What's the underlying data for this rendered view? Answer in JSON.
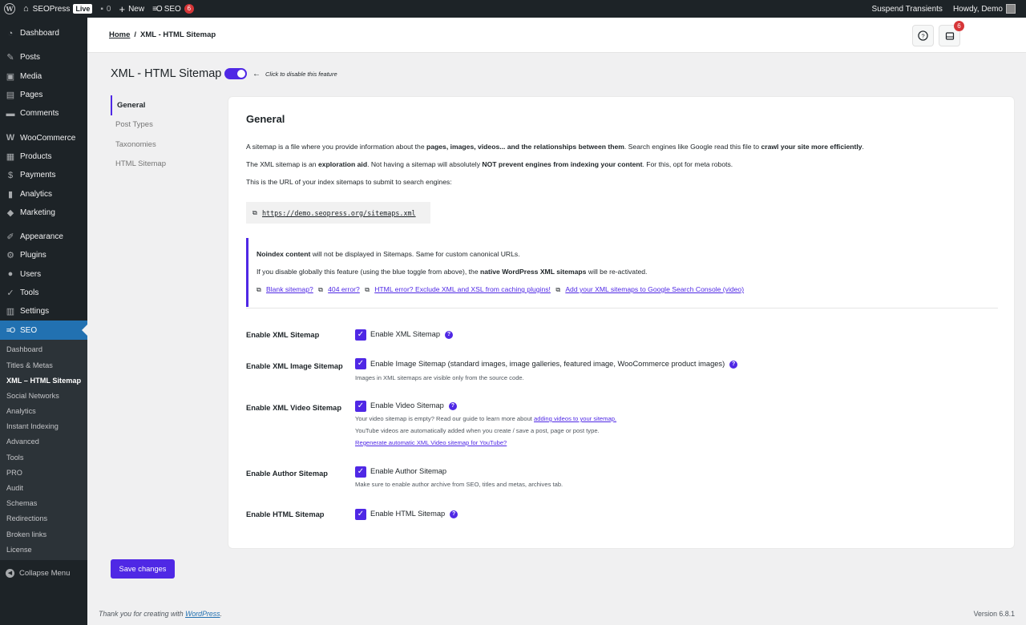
{
  "adminbar": {
    "site_name": "SEOPress",
    "live_badge": "Live",
    "comments_count": "0",
    "new_label": "New",
    "seo_label": "SEO",
    "seo_count": "6",
    "suspend_label": "Suspend Transients",
    "howdy_label": "Howdy, Demo"
  },
  "sidebar": {
    "items": [
      {
        "label": "Dashboard",
        "icon": "dashboard-icon"
      },
      {
        "label": "Posts",
        "icon": "pin-icon"
      },
      {
        "label": "Media",
        "icon": "media-icon"
      },
      {
        "label": "Pages",
        "icon": "page-icon"
      },
      {
        "label": "Comments",
        "icon": "comment-icon"
      },
      {
        "label": "WooCommerce",
        "icon": "woo-icon"
      },
      {
        "label": "Products",
        "icon": "products-icon"
      },
      {
        "label": "Payments",
        "icon": "payments-icon"
      },
      {
        "label": "Analytics",
        "icon": "analytics-icon"
      },
      {
        "label": "Marketing",
        "icon": "megaphone-icon"
      },
      {
        "label": "Appearance",
        "icon": "brush-icon"
      },
      {
        "label": "Plugins",
        "icon": "plug-icon"
      },
      {
        "label": "Users",
        "icon": "user-icon"
      },
      {
        "label": "Tools",
        "icon": "wrench-icon"
      },
      {
        "label": "Settings",
        "icon": "sliders-icon"
      },
      {
        "label": "SEO",
        "icon": "seo-icon"
      }
    ],
    "submenu": [
      "Dashboard",
      "Titles & Metas",
      "XML – HTML Sitemap",
      "Social Networks",
      "Analytics",
      "Instant Indexing",
      "Advanced",
      "Tools",
      "PRO",
      "Audit",
      "Schemas",
      "Redirections",
      "Broken links",
      "License"
    ],
    "collapse_label": "Collapse Menu"
  },
  "header": {
    "breadcrumb_home": "Home",
    "breadcrumb_sep": "/",
    "breadcrumb_current": "XML - HTML Sitemap",
    "notifications_count": "6"
  },
  "page": {
    "title": "XML - HTML Sitemap",
    "toggle_hint": "Click to disable this feature",
    "toggle_on": true
  },
  "tabs": [
    "General",
    "Post Types",
    "Taxonomies",
    "HTML Sitemap"
  ],
  "general": {
    "heading": "General",
    "p1_a": "A sitemap is a file where you provide information about the ",
    "p1_b": "pages, images, videos... and the relationships between them",
    "p1_c": ". Search engines like Google read this file to ",
    "p1_d": "crawl your site more efficiently",
    "p1_e": ".",
    "p2_a": "The XML sitemap is an ",
    "p2_b": "exploration aid",
    "p2_c": ". Not having a sitemap will absolutely ",
    "p2_d": "NOT prevent engines from indexing your content",
    "p2_e": ". For this, opt for meta robots.",
    "p3": "This is the URL of your index sitemaps to submit to search engines:",
    "sitemap_url": "https://demo.seopress.org/sitemaps.xml",
    "notice1_a": "Noindex content",
    "notice1_b": " will not be displayed in Sitemaps. Same for custom canonical URLs.",
    "notice2_a": "If you disable globally this feature (using the blue toggle from above), the ",
    "notice2_b": "native WordPress XML sitemaps",
    "notice2_c": " will be re-activated.",
    "links": [
      "Blank sitemap?",
      "404 error?",
      "HTML error? Exclude XML and XSL from caching plugins!",
      "Add your XML sitemaps to Google Search Console (video)"
    ]
  },
  "settings": {
    "xml": {
      "label": "Enable XML Sitemap",
      "cb": "Enable XML Sitemap"
    },
    "image": {
      "label": "Enable XML Image Sitemap",
      "cb": "Enable Image Sitemap (standard images, image galleries, featured image, WooCommerce product images)",
      "desc": "Images in XML sitemaps are visible only from the source code."
    },
    "video": {
      "label": "Enable XML Video Sitemap",
      "cb": "Enable Video Sitemap",
      "desc1": "Your video sitemap is empty? Read our guide to learn more about ",
      "desc1_link": "adding videos to your sitemap.",
      "desc2": "YouTube videos are automatically added when you create / save a post, page or post type.",
      "desc3_link": "Regenerate automatic XML Video sitemap for YouTube?"
    },
    "author": {
      "label": "Enable Author Sitemap",
      "cb": "Enable Author Sitemap",
      "desc": "Make sure to enable author archive from SEO, titles and metas, archives tab."
    },
    "html": {
      "label": "Enable HTML Sitemap",
      "cb": "Enable HTML Sitemap"
    }
  },
  "save_label": "Save changes",
  "footer": {
    "thanks": "Thank you for creating with ",
    "wp_link": "WordPress",
    "dot": ".",
    "version": "Version 6.8.1"
  },
  "colors": {
    "accent": "#4f28e5",
    "wp_blue": "#2271b1",
    "admin_dark": "#1d2327",
    "badge_red": "#d63638"
  }
}
